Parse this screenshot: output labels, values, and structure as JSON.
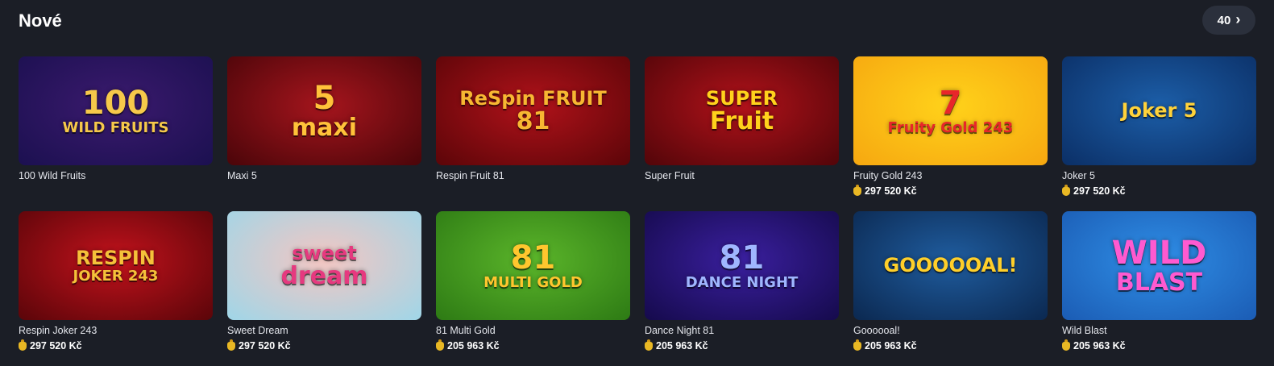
{
  "section": {
    "title": "Nové",
    "count_label": "40",
    "chevron": "›"
  },
  "games": [
    {
      "name": "100 Wild Fruits",
      "jackpot": "",
      "logo_line1": "100",
      "logo_line2": "WILD FRUITS",
      "bg": "#3b1a6e",
      "bg2": "#1b1050",
      "logo_color": "#f6c94a"
    },
    {
      "name": "Maxi 5",
      "jackpot": "",
      "logo_line1": "5",
      "logo_line2": "maxi",
      "bg": "#a5151d",
      "bg2": "#4a0509",
      "logo_color": "#ffc23a"
    },
    {
      "name": "Respin Fruit 81",
      "jackpot": "",
      "logo_line1": "ReSpin FRUIT",
      "logo_line2": "81",
      "bg": "#b0121a",
      "bg2": "#5b0508",
      "logo_color": "#f7b732"
    },
    {
      "name": "Super Fruit",
      "jackpot": "",
      "logo_line1": "SUPER",
      "logo_line2": "Fruit",
      "bg": "#b0121a",
      "bg2": "#520509",
      "logo_color": "#ffd21c"
    },
    {
      "name": "Fruity Gold 243",
      "jackpot": "297 520 Kč",
      "logo_line1": "7",
      "logo_line2": "Fruity Gold 243",
      "bg": "#ffd21a",
      "bg2": "#f6a710",
      "logo_color": "#e8262a"
    },
    {
      "name": "Joker 5",
      "jackpot": "297 520 Kč",
      "logo_line1": "Joker 5",
      "logo_line2": "",
      "bg": "#1c5ea8",
      "bg2": "#0b2f66",
      "logo_color": "#ffd23a"
    },
    {
      "name": "Respin Joker 243",
      "jackpot": "297 520 Kč",
      "logo_line1": "RESPIN",
      "logo_line2": "JOKER 243",
      "bg": "#c2121c",
      "bg2": "#5a0509",
      "logo_color": "#f5c13a"
    },
    {
      "name": "Sweet Dream",
      "jackpot": "297 520 Kč",
      "logo_line1": "sweet",
      "logo_line2": "dream",
      "bg": "#f3c6c2",
      "bg2": "#9fd6e8",
      "logo_color": "#e6397f"
    },
    {
      "name": "81 Multi Gold",
      "jackpot": "205 963 Kč",
      "logo_line1": "81",
      "logo_line2": "MULTI GOLD",
      "bg": "#5bb52a",
      "bg2": "#2d7a14",
      "logo_color": "#ffc62e"
    },
    {
      "name": "Dance Night 81",
      "jackpot": "205 963 Kč",
      "logo_line1": "81",
      "logo_line2": "DANCE NIGHT",
      "bg": "#3a1f9e",
      "bg2": "#150a4c",
      "logo_color": "#9fb6ff"
    },
    {
      "name": "Goooooal!",
      "jackpot": "205 963 Kč",
      "logo_line1": "GOOOOOAL!",
      "logo_line2": "",
      "bg": "#1f5c9e",
      "bg2": "#0b2850",
      "logo_color": "#ffcf2a"
    },
    {
      "name": "Wild Blast",
      "jackpot": "205 963 Kč",
      "logo_line1": "WILD",
      "logo_line2": "BLAST",
      "bg": "#2f8ee6",
      "bg2": "#1b5cb4",
      "logo_color": "#ff5ad0"
    }
  ]
}
